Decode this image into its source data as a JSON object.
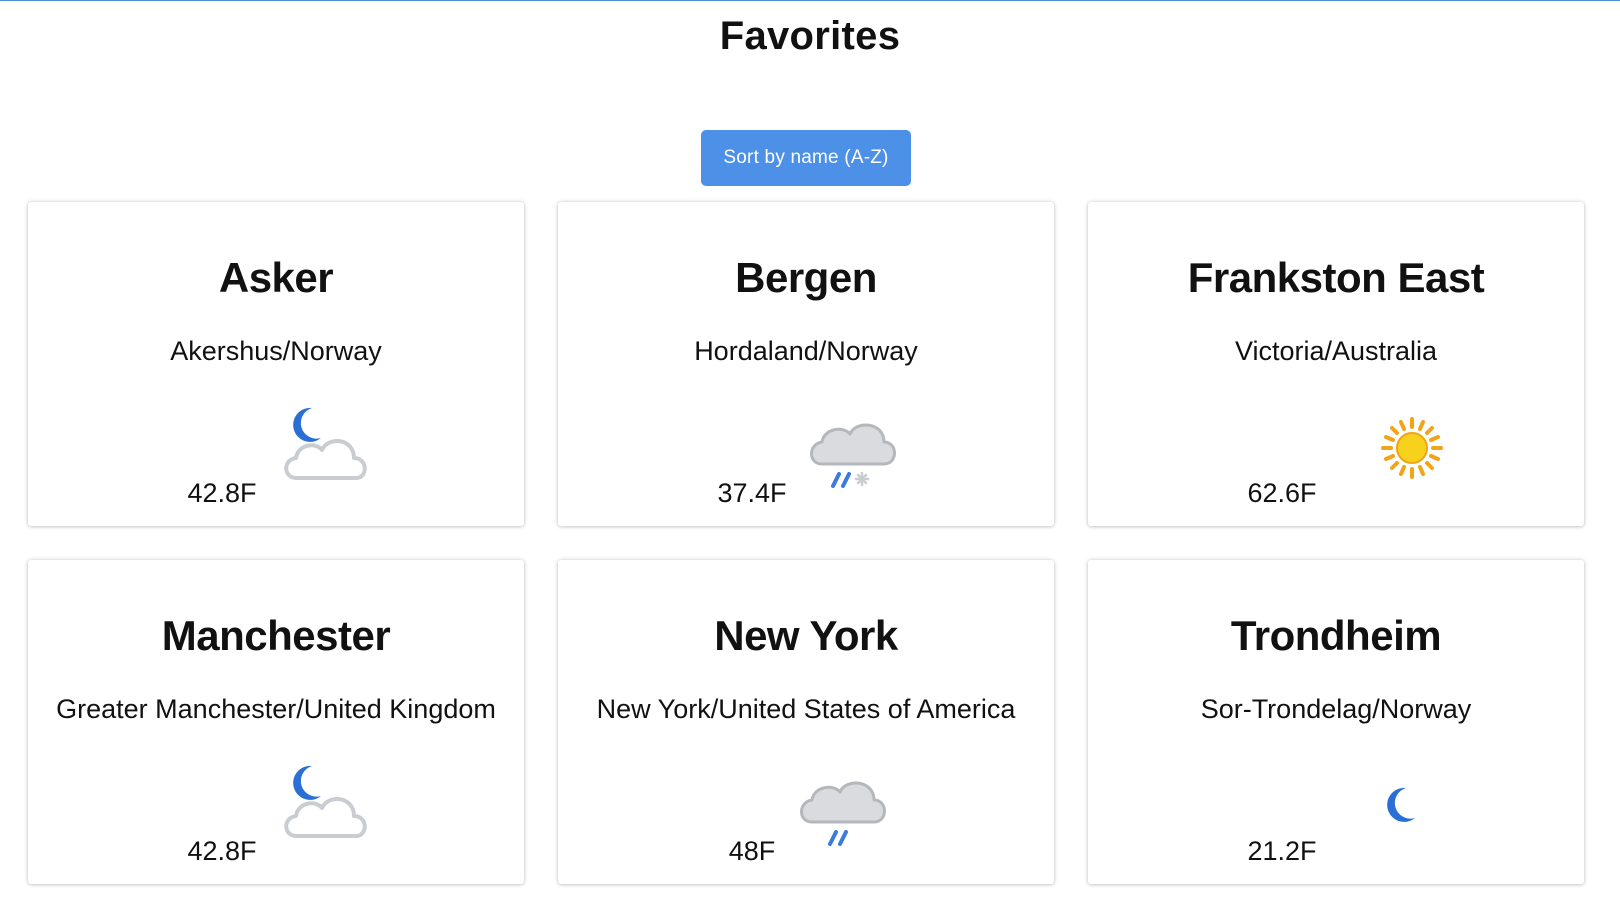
{
  "page": {
    "title": "Favorites"
  },
  "toolbar": {
    "sort_label": "Sort by name (A-Z)"
  },
  "colors": {
    "accent": "#4d90e8",
    "moon": "#2a6fd6",
    "sun": "#f5c518",
    "cloud_outline": "#c9cdd2",
    "cloud_fill": "#d9dbde"
  },
  "favorites": [
    {
      "city": "Asker",
      "region": "Akershus/Norway",
      "temperature": "42.8F",
      "icon": "moon-cloud-icon"
    },
    {
      "city": "Bergen",
      "region": "Hordaland/Norway",
      "temperature": "37.4F",
      "icon": "sleet-cloud-icon"
    },
    {
      "city": "Frankston East",
      "region": "Victoria/Australia",
      "temperature": "62.6F",
      "icon": "sun-icon"
    },
    {
      "city": "Manchester",
      "region": "Greater Manchester/United Kingdom",
      "temperature": "42.8F",
      "icon": "moon-cloud-icon"
    },
    {
      "city": "New York",
      "region": "New York/United States of America",
      "temperature": "48F",
      "icon": "rain-cloud-icon"
    },
    {
      "city": "Trondheim",
      "region": "Sor-Trondelag/Norway",
      "temperature": "21.2F",
      "icon": "moon-icon"
    }
  ]
}
